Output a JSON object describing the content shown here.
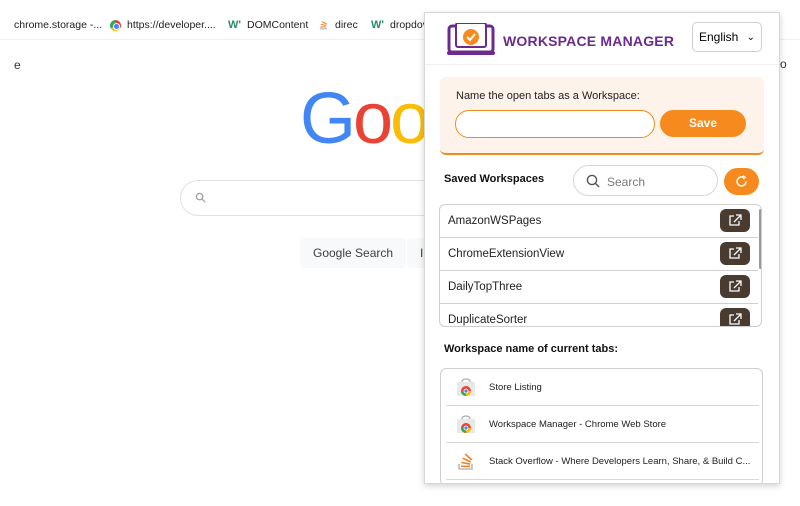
{
  "bookmarks": [
    {
      "label": "chrome.storage -...",
      "icon": "none"
    },
    {
      "label": "https://developer....",
      "icon": "chrome-icon"
    },
    {
      "label": "DOMContent",
      "icon": "w-icon"
    },
    {
      "label": "direc",
      "icon": "stackoverflow-icon"
    },
    {
      "label": "dropdov",
      "icon": "w-icon"
    }
  ],
  "background": {
    "left_letter": "e",
    "right_letter": "o",
    "logo_text": [
      "G",
      "o",
      "o"
    ],
    "search_button": "Google Search",
    "lucky_button_fragment": "I'"
  },
  "popup": {
    "title": "WORKSPACE MANAGER",
    "language": "English",
    "name_label": "Name the open tabs as a Workspace:",
    "name_input_value": "",
    "save_label": "Save",
    "saved_title": "Saved Workspaces",
    "search_placeholder": "Search",
    "saved_workspaces": [
      "AmazonWSPages",
      "ChromeExtensionView",
      "DailyTopThree",
      "DuplicateSorter"
    ],
    "current_tabs_title": "Workspace name of current tabs:",
    "current_tabs": [
      {
        "label": "Store Listing",
        "icon": "chrome-web-store-icon"
      },
      {
        "label": "Workspace Manager - Chrome Web Store",
        "icon": "chrome-web-store-icon"
      },
      {
        "label": "Stack Overflow - Where Developers Learn, Share, & Build C...",
        "icon": "stackoverflow-icon"
      }
    ],
    "colors": {
      "accent": "#f68a1f",
      "title": "#6b2b8e",
      "dark_button": "#4a3b30"
    }
  }
}
